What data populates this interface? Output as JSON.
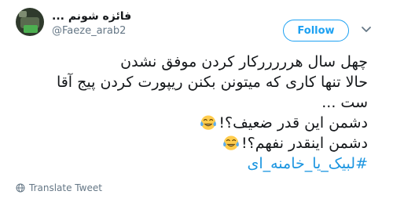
{
  "user": {
    "display_name": "فائزه شونم ...",
    "handle": "@Faeze_arab2"
  },
  "follow_button": {
    "label": "Follow"
  },
  "tweet": {
    "line1": "چهل سال هرررررکار کردن موفق نشدن",
    "line2": "حالا تنها کاری که میتونن بکنن ریپورت کردن پیج آقا",
    "line3": "ست ...",
    "line4": "دشمن این قدر ضعیف؟!",
    "line5": "دشمن اینقدر نفهم؟!",
    "hashtag": "#لبیک_یا_خامنه_ای"
  },
  "emoji": {
    "name": "face-with-tears-of-joy"
  },
  "translate": {
    "label": "Translate Tweet"
  },
  "colors": {
    "accent": "#1da1f2",
    "hashtag": "#1b95e0",
    "secondary_text": "#657786",
    "text": "#14171a"
  }
}
